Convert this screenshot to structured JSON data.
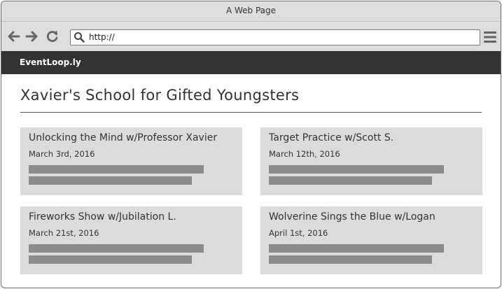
{
  "window": {
    "title": "A Web Page"
  },
  "toolbar": {
    "url": "http://",
    "icons": [
      "back-arrow-icon",
      "forward-arrow-icon",
      "refresh-icon",
      "search-icon",
      "hamburger-menu-icon"
    ]
  },
  "navbar": {
    "brand": "EventLoop.ly"
  },
  "page": {
    "title": "Xavier's School for Gifted Youngsters"
  },
  "events": [
    {
      "title": "Unlocking the Mind w/Professor Xavier",
      "date": "March 3rd, 2016"
    },
    {
      "title": "Target Practice w/Scott S.",
      "date": "March 12th, 2016"
    },
    {
      "title": "Fireworks Show w/Jubilation L.",
      "date": "March 21st, 2016"
    },
    {
      "title": "Wolverine Sings the Blue w/Logan",
      "date": "April 1st, 2016"
    }
  ],
  "colors": {
    "chrome": "#dedede",
    "navbar": "#333333",
    "card": "#dcdcdc",
    "placeholder_line": "#8c8c8c"
  }
}
